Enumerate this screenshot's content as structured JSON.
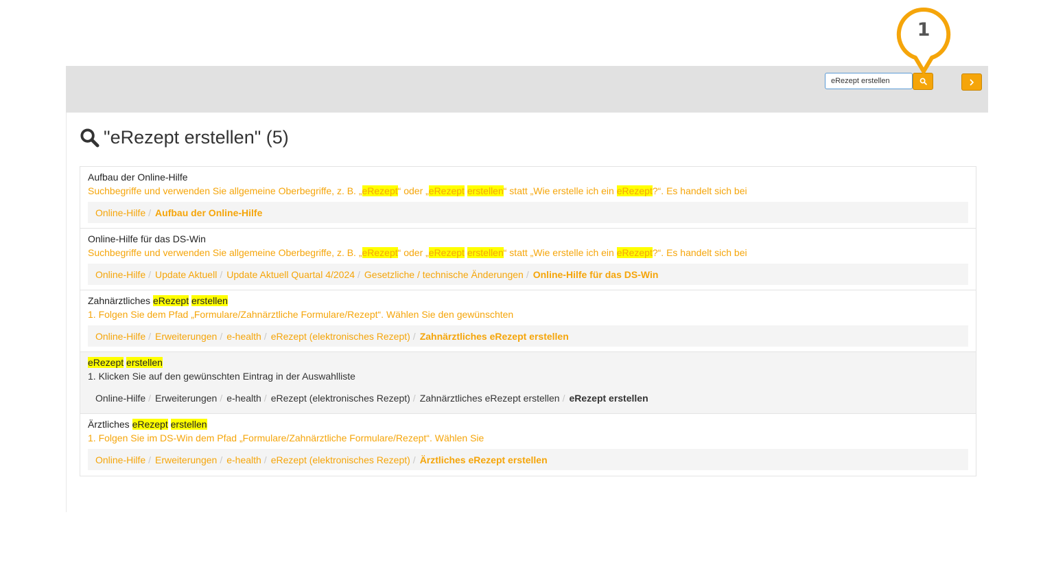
{
  "search": {
    "value": "eRezept erstellen"
  },
  "callout": {
    "number": "1"
  },
  "heading": {
    "text": "\"eRezept erstellen\" (5)"
  },
  "colors": {
    "accent": "#f5a50a",
    "highlight": "#ffff00",
    "topbar": "#e1e1e1"
  },
  "icons": {
    "search": "magnifier-icon",
    "next": "chevron-right-icon"
  },
  "results": [
    {
      "title": "Aufbau der Online-Hilfe",
      "snippet": {
        "p1": "Suchbegriffe und verwenden Sie allgemeine Oberbegriffe, z. B. „",
        "h1": "eRezept",
        "p2": "“ oder „",
        "h2": "eRezept",
        "p3": " ",
        "h3": "erstellen",
        "p4": "“ statt „Wie erstelle ich ein ",
        "h4": "eRezept",
        "p5": "?“. Es handelt sich bei"
      },
      "breadcrumb": [
        "Online-Hilfe",
        "Aufbau der Online-Hilfe"
      ]
    },
    {
      "title": "Online-Hilfe für das DS-Win",
      "snippet": {
        "p1": "Suchbegriffe und verwenden Sie allgemeine Oberbegriffe, z. B. „",
        "h1": "eRezept",
        "p2": "“ oder „",
        "h2": "eRezept",
        "p3": " ",
        "h3": "erstellen",
        "p4": "“ statt „Wie erstelle ich ein ",
        "h4": "eRezept",
        "p5": "?“. Es handelt sich bei"
      },
      "breadcrumb": [
        "Online-Hilfe",
        "Update Aktuell",
        "Update Aktuell Quartal 4/2024",
        "Gesetzliche / technische Änderungen",
        "Online-Hilfe für das DS-Win"
      ]
    },
    {
      "title": {
        "p1": "Zahnärztliches ",
        "h1": "eRezept",
        "p2": " ",
        "h2": "erstellen"
      },
      "snippet": "1. Folgen Sie dem Pfad „Formulare/Zahnärztliche Formulare/Rezept“. Wählen Sie den gewünschten",
      "breadcrumb": [
        "Online-Hilfe",
        "Erweiterungen",
        "e-health",
        "eRezept (elektronisches Rezept)",
        "Zahnärztliches eRezept erstellen"
      ]
    },
    {
      "title": {
        "h1": "eRezept",
        "p1": " ",
        "h2": "erstellen"
      },
      "snippet": "1. Klicken Sie auf den gewünschten Eintrag in der Auswahlliste",
      "breadcrumb": [
        "Online-Hilfe",
        "Erweiterungen",
        "e-health",
        "eRezept (elektronisches Rezept)",
        "Zahnärztliches eRezept erstellen",
        "eRezept erstellen"
      ]
    },
    {
      "title": {
        "p1": "Ärztliches ",
        "h1": "eRezept",
        "p2": " ",
        "h2": "erstellen"
      },
      "snippet": "1. Folgen Sie im DS-Win dem Pfad „Formulare/Zahnärztliche Formulare/Rezept“. Wählen Sie",
      "breadcrumb": [
        "Online-Hilfe",
        "Erweiterungen",
        "e-health",
        "eRezept (elektronisches Rezept)",
        "Ärztliches eRezept erstellen"
      ]
    }
  ]
}
